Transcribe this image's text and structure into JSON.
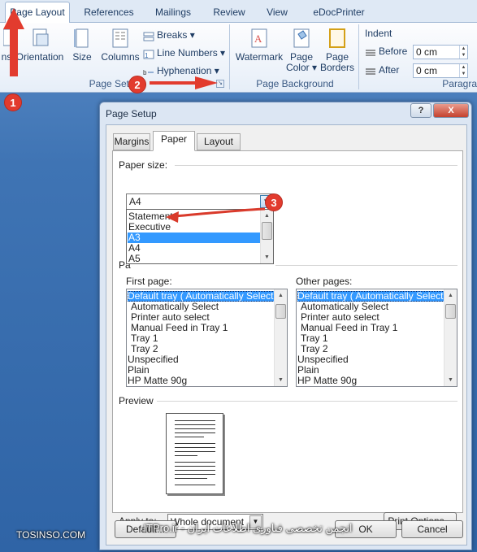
{
  "ribbon": {
    "tabs": [
      "Page Layout",
      "References",
      "Mailings",
      "Review",
      "View",
      "eDocPrinter"
    ],
    "page_setup": {
      "group_label": "Page Setup",
      "margins_partial": "ns",
      "orientation": "Orientation",
      "size": "Size",
      "columns": "Columns",
      "breaks": "Breaks",
      "line_numbers": "Line Numbers",
      "hyphenation": "Hyphenation"
    },
    "page_background": {
      "group_label": "Page Background",
      "watermark": "Watermark",
      "page_color_1": "Page",
      "page_color_2": "Color",
      "page_borders_1": "Page",
      "page_borders_2": "Borders"
    },
    "paragraph": {
      "group_label": "Paragra",
      "indent": "Indent",
      "before_label": "Before",
      "before_value": "0 cm",
      "after_label": "After",
      "after_value": "0 cm"
    }
  },
  "annotations": [
    "1",
    "2",
    "3"
  ],
  "dialog": {
    "title": "Page Setup",
    "help": "?",
    "close": "X",
    "tabs": [
      "Margins",
      "Paper",
      "Layout"
    ],
    "active_tab": "Paper",
    "paper_size_label": "Paper size:",
    "paper_size_value": "A4",
    "paper_size_options": [
      "Statement",
      "Executive",
      "A3",
      "A4",
      "A5"
    ],
    "paper_size_highlighted": "A3",
    "paper_source_partial": "Pa",
    "first_page_label": "First page:",
    "other_pages_label": "Other pages:",
    "trays": [
      "Default tray ( Automatically Select)",
      "Automatically Select",
      "Printer auto select",
      "Manual Feed in Tray 1",
      "Tray 1",
      "Tray 2",
      "Unspecified",
      "Plain",
      "HP Matte 90g"
    ],
    "preview_label": "Preview",
    "apply_to_label": "Apply to:",
    "apply_to_value": "Whole document",
    "print_options": "Print Options...",
    "default_button": "Default...",
    "ok_button": "OK",
    "cancel_button": "Cancel"
  },
  "watermark_text": {
    "left": "TOSINSO.COM",
    "center": "ITPro.ir - انجمن تخصصی فناوری اطلاعات ایران"
  },
  "colors": {
    "annotation_red": "#e23b2e",
    "selection_blue": "#3399ff"
  }
}
